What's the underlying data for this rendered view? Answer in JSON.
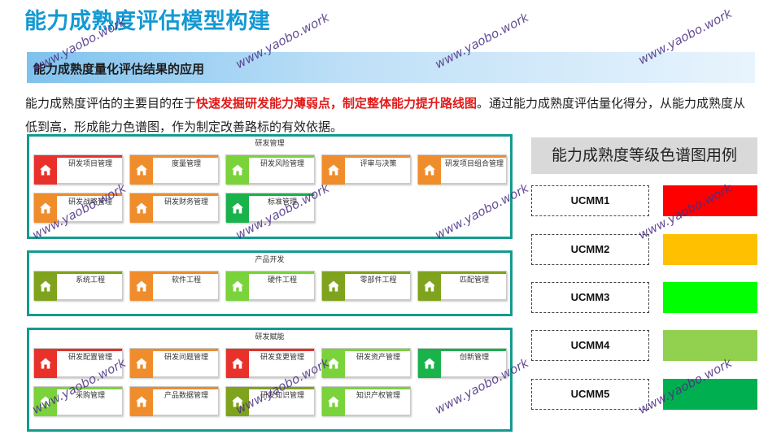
{
  "page": {
    "title": "能力成熟度评估模型构建"
  },
  "subtitle": "能力成熟度量化评估结果的应用",
  "paragraph": {
    "p1": "能力成熟度评估的主要目的在于",
    "highlight": "快速发掘研发能力薄弱点，制定整体能力提升路线图",
    "p2": "。通过能力成熟度评估量化得分，从能力成熟度从低到高，形成能力色谱图，作为制定改善路标的有效依据。"
  },
  "groups": [
    {
      "title": "研发管理",
      "items": [
        {
          "label": "研发项目管理",
          "level": 1
        },
        {
          "label": "度量管理",
          "level": 2
        },
        {
          "label": "研发风险管理",
          "level": 3
        },
        {
          "label": "评审与决策",
          "level": 2
        },
        {
          "label": "研发项目组合管理",
          "level": 2
        },
        {
          "label": "研发战略管理",
          "level": 2
        },
        {
          "label": "研发财务管理",
          "level": 2
        },
        {
          "label": "标准管理",
          "level": 5
        }
      ]
    },
    {
      "title": "产品开发",
      "items": [
        {
          "label": "系统工程",
          "level": 4
        },
        {
          "label": "软件工程",
          "level": 2
        },
        {
          "label": "硬件工程",
          "level": 3
        },
        {
          "label": "零部件工程",
          "level": 4
        },
        {
          "label": "匹配管理",
          "level": 4
        }
      ]
    },
    {
      "title": "研发赋能",
      "items": [
        {
          "label": "研发配置管理",
          "level": 1
        },
        {
          "label": "研发问题管理",
          "level": 2
        },
        {
          "label": "研发变更管理",
          "level": 1
        },
        {
          "label": "研发资产管理",
          "level": 3
        },
        {
          "label": "创新管理",
          "level": 5
        },
        {
          "label": "采购管理",
          "level": 3
        },
        {
          "label": "产品数据管理",
          "level": 2
        },
        {
          "label": "研发知识管理",
          "level": 4
        },
        {
          "label": "知识产权管理",
          "level": 3
        }
      ]
    }
  ],
  "legend": {
    "title": "能力成熟度等级色谱图用例",
    "levels": [
      {
        "label": "UCMM1",
        "color": "#ff0000"
      },
      {
        "label": "UCMM2",
        "color": "#ffc000"
      },
      {
        "label": "UCMM3",
        "color": "#00ff00"
      },
      {
        "label": "UCMM4",
        "color": "#92d050"
      },
      {
        "label": "UCMM5",
        "color": "#00b050"
      }
    ]
  },
  "card_colors": {
    "1": "#e8312a",
    "2": "#ef8c2b",
    "3": "#7ad33a",
    "4": "#7fa31c",
    "5": "#19b24b"
  },
  "watermark": "www.yaobo.work"
}
